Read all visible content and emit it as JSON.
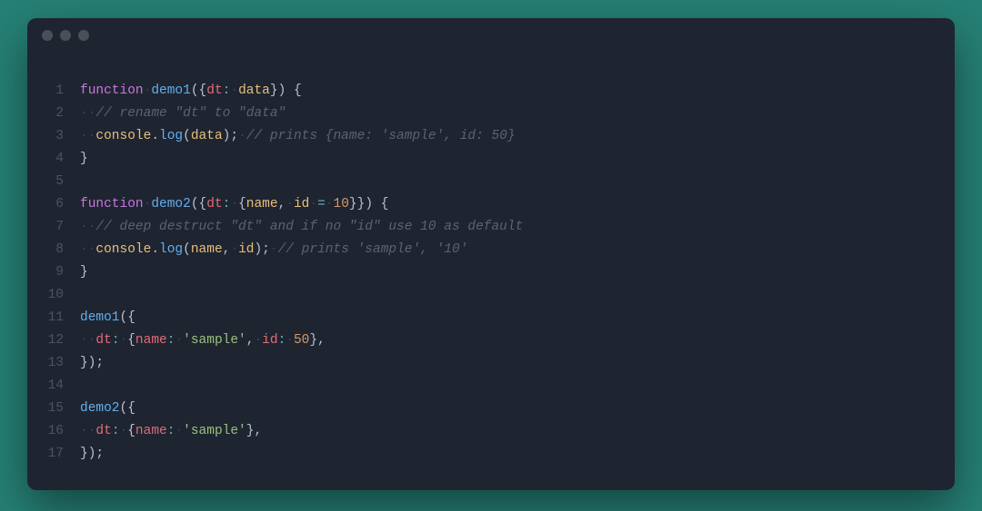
{
  "colors": {
    "editor_bg": "#1f2431",
    "page_bg": "#268075",
    "gutter": "#4c5363",
    "whitespace": "#39404f",
    "keyword": "#c678dd",
    "function": "#61afef",
    "property": "#e06c75",
    "identifier": "#e5c07b",
    "number": "#d19a66",
    "string": "#98c379",
    "comment": "#5c6370",
    "operator": "#56b6c2",
    "text": "#b9c0cf"
  },
  "line_numbers": [
    "1",
    "2",
    "3",
    "4",
    "5",
    "6",
    "7",
    "8",
    "9",
    "10",
    "11",
    "12",
    "13",
    "14",
    "15",
    "16",
    "17"
  ],
  "lines": [
    [
      {
        "c": "kw",
        "t": "function"
      },
      {
        "c": "ws",
        "t": "·"
      },
      {
        "c": "fn",
        "t": "demo1"
      },
      {
        "c": "punc",
        "t": "("
      },
      {
        "c": "punc",
        "t": "{"
      },
      {
        "c": "prop",
        "t": "dt"
      },
      {
        "c": "op",
        "t": ":"
      },
      {
        "c": "ws",
        "t": "·"
      },
      {
        "c": "ident",
        "t": "data"
      },
      {
        "c": "punc",
        "t": "}"
      },
      {
        "c": "punc",
        "t": ")"
      },
      {
        "c": "punc",
        "t": " {"
      }
    ],
    [
      {
        "c": "ws",
        "t": "··"
      },
      {
        "c": "cmt",
        "t": "// rename \"dt\" to \"data\""
      }
    ],
    [
      {
        "c": "ws",
        "t": "··"
      },
      {
        "c": "ident",
        "t": "console"
      },
      {
        "c": "punc",
        "t": "."
      },
      {
        "c": "fn",
        "t": "log"
      },
      {
        "c": "punc",
        "t": "("
      },
      {
        "c": "ident",
        "t": "data"
      },
      {
        "c": "punc",
        "t": ");"
      },
      {
        "c": "ws",
        "t": "·"
      },
      {
        "c": "cmt",
        "t": "// prints {name: 'sample', id: 50}"
      }
    ],
    [
      {
        "c": "punc",
        "t": "}"
      }
    ],
    [],
    [
      {
        "c": "kw",
        "t": "function"
      },
      {
        "c": "ws",
        "t": "·"
      },
      {
        "c": "fn",
        "t": "demo2"
      },
      {
        "c": "punc",
        "t": "("
      },
      {
        "c": "punc",
        "t": "{"
      },
      {
        "c": "prop",
        "t": "dt"
      },
      {
        "c": "op",
        "t": ":"
      },
      {
        "c": "ws",
        "t": "·"
      },
      {
        "c": "punc",
        "t": "{"
      },
      {
        "c": "ident",
        "t": "name"
      },
      {
        "c": "punc",
        "t": ","
      },
      {
        "c": "ws",
        "t": "·"
      },
      {
        "c": "ident",
        "t": "id"
      },
      {
        "c": "ws",
        "t": "·"
      },
      {
        "c": "op",
        "t": "="
      },
      {
        "c": "ws",
        "t": "·"
      },
      {
        "c": "num",
        "t": "10"
      },
      {
        "c": "punc",
        "t": "}}"
      },
      {
        "c": "punc",
        "t": ")"
      },
      {
        "c": "punc",
        "t": " {"
      }
    ],
    [
      {
        "c": "ws",
        "t": "··"
      },
      {
        "c": "cmt",
        "t": "// deep destruct \"dt\" and if no \"id\" use 10 as default"
      }
    ],
    [
      {
        "c": "ws",
        "t": "··"
      },
      {
        "c": "ident",
        "t": "console"
      },
      {
        "c": "punc",
        "t": "."
      },
      {
        "c": "fn",
        "t": "log"
      },
      {
        "c": "punc",
        "t": "("
      },
      {
        "c": "ident",
        "t": "name"
      },
      {
        "c": "punc",
        "t": ","
      },
      {
        "c": "ws",
        "t": "·"
      },
      {
        "c": "ident",
        "t": "id"
      },
      {
        "c": "punc",
        "t": ");"
      },
      {
        "c": "ws",
        "t": "·"
      },
      {
        "c": "cmt",
        "t": "// prints 'sample', '10'"
      }
    ],
    [
      {
        "c": "punc",
        "t": "}"
      }
    ],
    [],
    [
      {
        "c": "fn",
        "t": "demo1"
      },
      {
        "c": "punc",
        "t": "({"
      }
    ],
    [
      {
        "c": "ws",
        "t": "··"
      },
      {
        "c": "prop",
        "t": "dt"
      },
      {
        "c": "op",
        "t": ":"
      },
      {
        "c": "ws",
        "t": "·"
      },
      {
        "c": "punc",
        "t": "{"
      },
      {
        "c": "prop",
        "t": "name"
      },
      {
        "c": "op",
        "t": ":"
      },
      {
        "c": "ws",
        "t": "·"
      },
      {
        "c": "str",
        "t": "'sample'"
      },
      {
        "c": "punc",
        "t": ","
      },
      {
        "c": "ws",
        "t": "·"
      },
      {
        "c": "prop",
        "t": "id"
      },
      {
        "c": "op",
        "t": ":"
      },
      {
        "c": "ws",
        "t": "·"
      },
      {
        "c": "num",
        "t": "50"
      },
      {
        "c": "punc",
        "t": "},"
      }
    ],
    [
      {
        "c": "punc",
        "t": "});"
      }
    ],
    [],
    [
      {
        "c": "fn",
        "t": "demo2"
      },
      {
        "c": "punc",
        "t": "({"
      }
    ],
    [
      {
        "c": "ws",
        "t": "··"
      },
      {
        "c": "prop",
        "t": "dt"
      },
      {
        "c": "op",
        "t": ":"
      },
      {
        "c": "ws",
        "t": "·"
      },
      {
        "c": "punc",
        "t": "{"
      },
      {
        "c": "prop",
        "t": "name"
      },
      {
        "c": "op",
        "t": ":"
      },
      {
        "c": "ws",
        "t": "·"
      },
      {
        "c": "str",
        "t": "'sample'"
      },
      {
        "c": "punc",
        "t": "},"
      }
    ],
    [
      {
        "c": "punc",
        "t": "});"
      }
    ]
  ]
}
